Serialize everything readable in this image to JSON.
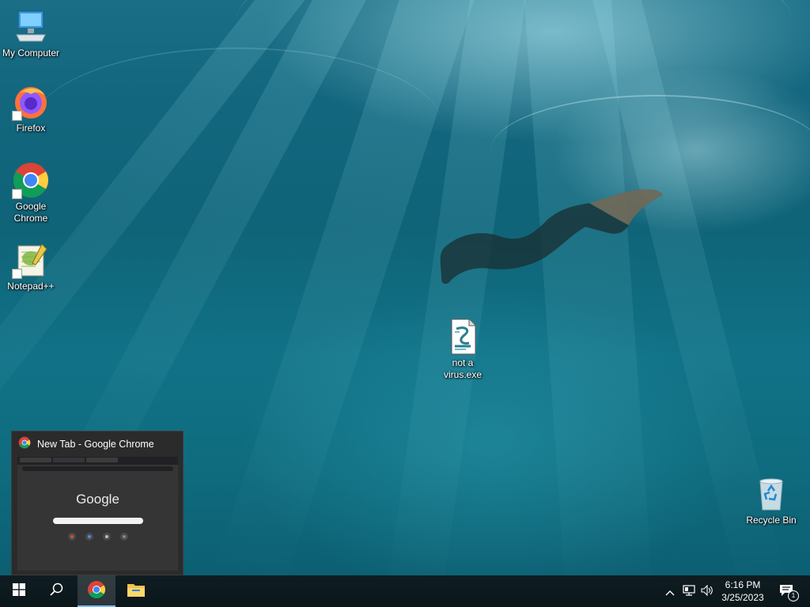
{
  "desktop": {
    "icons": [
      {
        "label": "My Computer"
      },
      {
        "label": "Firefox"
      },
      {
        "label": "Google Chrome"
      },
      {
        "label": "Notepad++"
      },
      {
        "label": "not a virus.exe"
      },
      {
        "label": "Recycle Bin"
      }
    ]
  },
  "preview": {
    "title": "New Tab - Google Chrome",
    "thumb_logo": "Google"
  },
  "taskbar": {
    "pinned": [
      {
        "name": "start",
        "icon": "windows-logo-icon"
      },
      {
        "name": "search",
        "icon": "search-icon"
      },
      {
        "name": "chrome",
        "icon": "chrome-icon",
        "active": true
      },
      {
        "name": "file-explorer",
        "icon": "folder-icon"
      }
    ],
    "tray": {
      "time": "6:16 PM",
      "date": "3/25/2023",
      "notification_count": "1"
    }
  },
  "colors": {
    "taskbar_bg": "#0d1a1f",
    "accent": "#76b9ed",
    "wallpaper_water": "#117287"
  }
}
